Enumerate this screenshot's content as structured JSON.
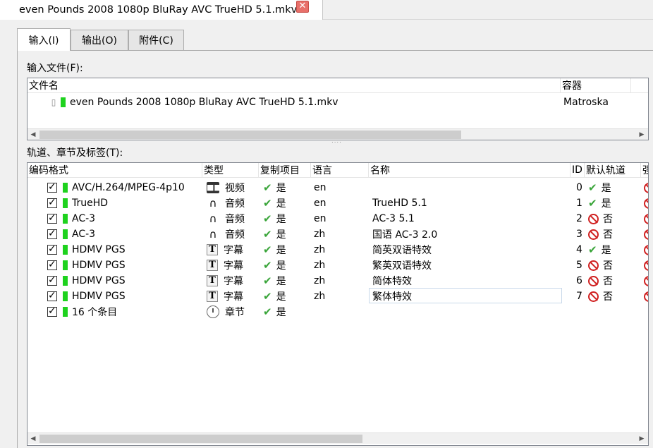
{
  "document_tab": {
    "title": "even Pounds 2008 1080p BluRay AVC TrueHD 5.1.mkv",
    "close": "✕"
  },
  "tabs": [
    "输入(I)",
    "输出(O)",
    "附件(C)"
  ],
  "input_files": {
    "label": "输入文件(F):",
    "columns": [
      "文件名",
      "容器"
    ],
    "rows": [
      {
        "name": "even Pounds 2008 1080p BluRay AVC TrueHD 5.1.mkv",
        "container": "Matroska"
      }
    ]
  },
  "tracks": {
    "label": "轨道、章节及标签(T):",
    "columns": [
      "编码格式",
      "类型",
      "复制项目",
      "语言",
      "名称",
      "ID",
      "默认轨道",
      "强"
    ],
    "rows": [
      {
        "codec": "AVC/H.264/MPEG-4p10",
        "icon": "film-icon",
        "type": "视频",
        "copy": "是",
        "lang": "en",
        "name": "",
        "id": "0",
        "default_icon": "check",
        "default": "是"
      },
      {
        "codec": "TrueHD",
        "icon": "headphones-icon",
        "type": "音频",
        "copy": "是",
        "lang": "en",
        "name": "TrueHD 5.1",
        "id": "1",
        "default_icon": "check",
        "default": "是"
      },
      {
        "codec": "AC-3",
        "icon": "headphones-icon",
        "type": "音频",
        "copy": "是",
        "lang": "en",
        "name": "AC-3 5.1",
        "id": "2",
        "default_icon": "no",
        "default": "否"
      },
      {
        "codec": "AC-3",
        "icon": "headphones-icon",
        "type": "音频",
        "copy": "是",
        "lang": "zh",
        "name": "国语 AC-3 2.0",
        "id": "3",
        "default_icon": "no",
        "default": "否"
      },
      {
        "codec": "HDMV PGS",
        "icon": "text-icon",
        "type": "字幕",
        "copy": "是",
        "lang": "zh",
        "name": "简英双语特效",
        "id": "4",
        "default_icon": "check",
        "default": "是"
      },
      {
        "codec": "HDMV PGS",
        "icon": "text-icon",
        "type": "字幕",
        "copy": "是",
        "lang": "zh",
        "name": "繁英双语特效",
        "id": "5",
        "default_icon": "no",
        "default": "否"
      },
      {
        "codec": "HDMV PGS",
        "icon": "text-icon",
        "type": "字幕",
        "copy": "是",
        "lang": "zh",
        "name": "简体特效",
        "id": "6",
        "default_icon": "no",
        "default": "否"
      },
      {
        "codec": "HDMV PGS",
        "icon": "text-icon",
        "type": "字幕",
        "copy": "是",
        "lang": "zh",
        "name": "繁体特效",
        "id": "7",
        "default_icon": "no",
        "default": "否"
      },
      {
        "codec": "16 个条目",
        "icon": "clock-icon",
        "type": "章节",
        "copy": "是",
        "lang": "",
        "name": "",
        "id": "",
        "default_icon": "",
        "default": ""
      }
    ]
  },
  "glyphs": {
    "check": "✔",
    "film": "🎬",
    "headphones": "🎧",
    "text": "T",
    "left": "◀",
    "right": "▶",
    "grip": "::::"
  },
  "colors": {
    "green_marker": "#1ed21e",
    "check_green": "#3aa53a",
    "no_red": "#d02020"
  }
}
